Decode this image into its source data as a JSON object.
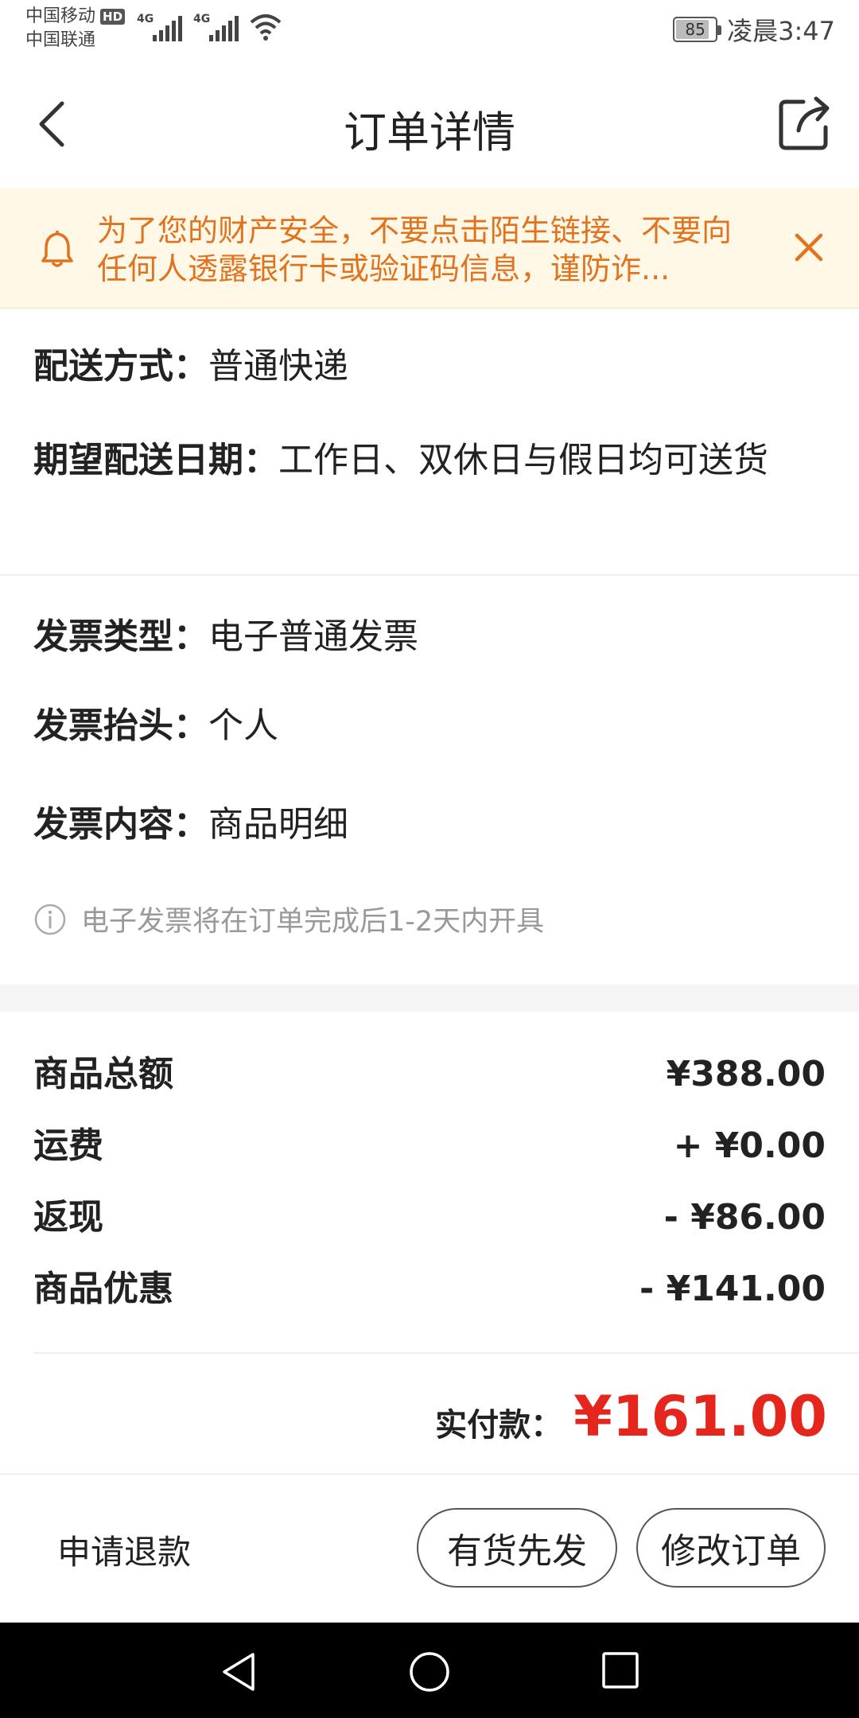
{
  "status_bar": {
    "carrier_1": "中国移动",
    "carrier_1_badge": "HD",
    "carrier_2": "中国联通",
    "network_1": "4G",
    "network_2": "4G",
    "battery": "85",
    "battery_level": 0.85,
    "time": "凌晨3:47"
  },
  "header": {
    "title": "订单详情",
    "back_icon": "chevron-left-icon",
    "share_icon": "share-icon"
  },
  "notice": {
    "icon": "bell-icon",
    "text": "为了您的财产安全，不要点击陌生链接、不要向任何人透露银行卡或验证码信息，谨防诈...",
    "close_icon": "close-icon",
    "color": "#e0731f"
  },
  "delivery": {
    "method_label": "配送方式：",
    "method_value": "普通快递",
    "date_label": "期望配送日期：",
    "date_value": "工作日、双休日与假日均可送货"
  },
  "invoice": {
    "type_label": "发票类型：",
    "type_value": "电子普通发票",
    "title_label": "发票抬头：",
    "title_value": "个人",
    "content_label": "发票内容：",
    "content_value": "商品明细",
    "note": "电子发票将在订单完成后1-2天内开具"
  },
  "amounts": {
    "items": [
      {
        "label": "商品总额",
        "value": "¥388.00"
      },
      {
        "label": "运费",
        "value": "+ ¥0.00"
      },
      {
        "label": "返现",
        "value": "- ¥86.00"
      },
      {
        "label": "商品优惠",
        "value": "- ¥141.00"
      }
    ],
    "total_label": "实付款：",
    "total_value": "¥161.00",
    "total_color": "#e4261c"
  },
  "actions": {
    "refund": "申请退款",
    "ship_available": "有货先发",
    "modify_order": "修改订单"
  }
}
